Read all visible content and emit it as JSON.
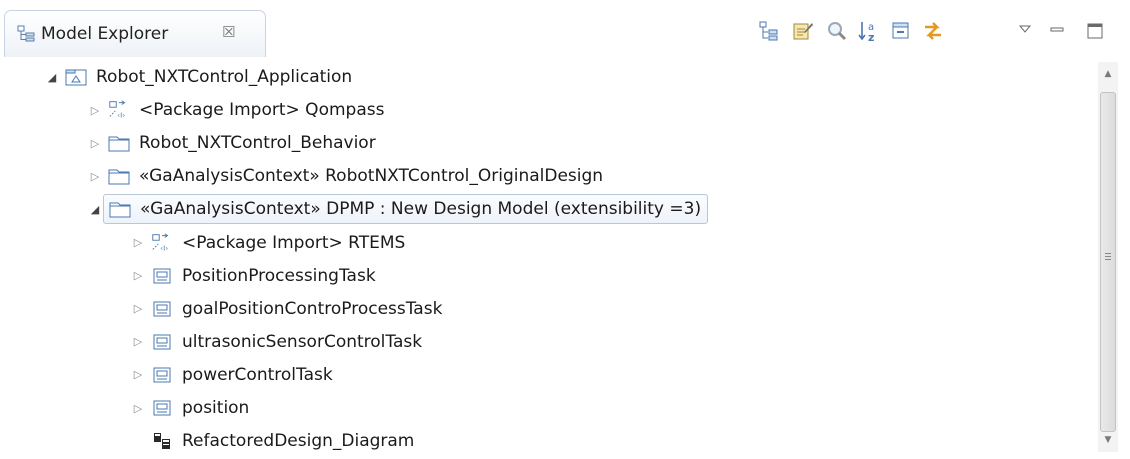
{
  "tab": {
    "title": "Model Explorer",
    "close": "☒"
  },
  "toolbar": [
    "link-with-editor-icon",
    "customize-icon",
    "search-icon",
    "sort-alphabetically-icon",
    "collapse-all-icon",
    "sync-icon",
    "view-menu-icon",
    "minimize-icon",
    "maximize-icon"
  ],
  "tree": [
    {
      "label": "Robot_NXTControl_Application",
      "icon": "model-icon",
      "expanded": true,
      "depth": 0
    },
    {
      "label": "<Package Import> Qompass",
      "icon": "package-import-icon",
      "expanded": false,
      "depth": 1
    },
    {
      "label": "Robot_NXTControl_Behavior",
      "icon": "package-icon",
      "expanded": false,
      "depth": 1
    },
    {
      "label": "«GaAnalysisContext» RobotNXTControl_OriginalDesign",
      "icon": "package-icon",
      "expanded": false,
      "depth": 1
    },
    {
      "label": "«GaAnalysisContext» DPMP : New Design Model (extensibility =3)",
      "icon": "package-icon",
      "expanded": true,
      "depth": 1,
      "selected": true
    },
    {
      "label": "<Package Import> RTEMS",
      "icon": "package-import-icon",
      "expanded": false,
      "depth": 2
    },
    {
      "label": "PositionProcessingTask",
      "icon": "component-icon",
      "expanded": false,
      "depth": 2
    },
    {
      "label": "goalPositionControProcessTask",
      "icon": "component-icon",
      "expanded": false,
      "depth": 2
    },
    {
      "label": "ultrasonicSensorControlTask",
      "icon": "component-icon",
      "expanded": false,
      "depth": 2
    },
    {
      "label": "powerControlTask",
      "icon": "component-icon",
      "expanded": false,
      "depth": 2
    },
    {
      "label": "position",
      "icon": "component-icon",
      "expanded": false,
      "depth": 2
    },
    {
      "label": "RefactoredDesign_Diagram",
      "icon": "diagram-icon",
      "leaf": true,
      "depth": 2
    }
  ],
  "colors": {
    "selection_border": "#b8c7d9",
    "package_icon": "#4a78b0",
    "toolbar_accent": "#e39a1c"
  }
}
